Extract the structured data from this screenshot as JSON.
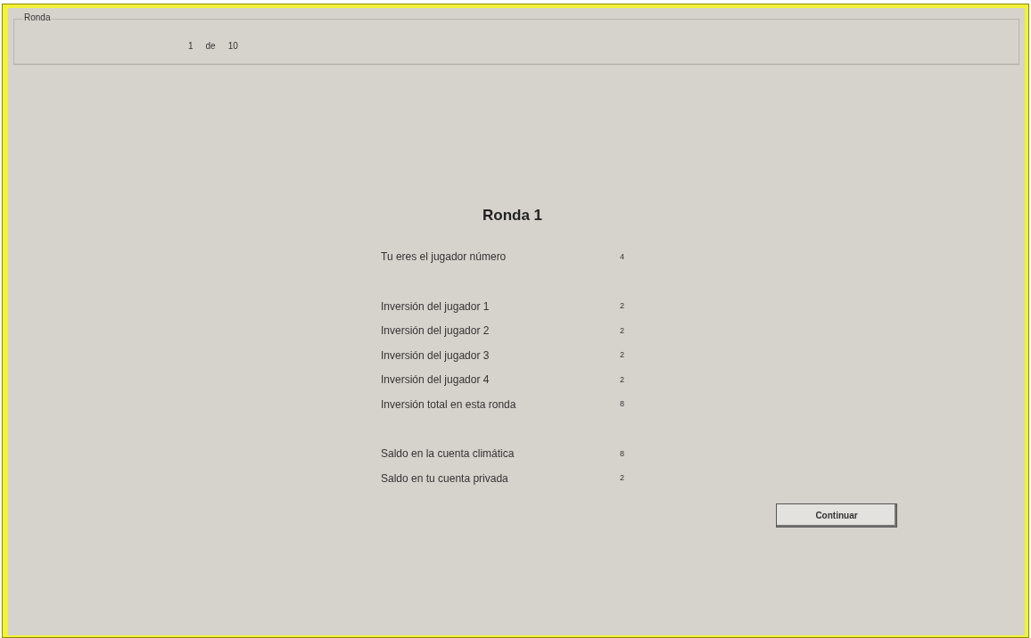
{
  "header": {
    "title": "Ronda",
    "round": "1",
    "separator": "de",
    "total": "10"
  },
  "summary": {
    "title": "Ronda 1",
    "groups": [
      {
        "rows": [
          {
            "label": "Tu eres el jugador número",
            "value": "4"
          }
        ]
      },
      {
        "rows": [
          {
            "label": "Inversión del jugador 1",
            "value": "2"
          },
          {
            "label": "Inversión del jugador 2",
            "value": "2"
          },
          {
            "label": "Inversión del jugador 3",
            "value": "2"
          },
          {
            "label": "Inversión del jugador 4",
            "value": "2"
          },
          {
            "label": "Inversión total en esta ronda",
            "value": "8"
          }
        ]
      },
      {
        "rows": [
          {
            "label": "Saldo en la cuenta climática",
            "value": "8"
          },
          {
            "label": "Saldo en tu cuenta privada",
            "value": "2"
          }
        ]
      }
    ]
  },
  "button": "Continuar"
}
